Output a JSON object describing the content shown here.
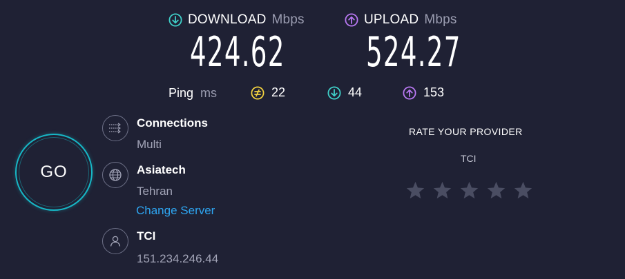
{
  "download": {
    "label": "DOWNLOAD",
    "unit": "Mbps",
    "value": "424.62",
    "color": "#3fd0c9"
  },
  "upload": {
    "label": "UPLOAD",
    "unit": "Mbps",
    "value": "524.27",
    "color": "#b878f2"
  },
  "ping": {
    "label": "Ping",
    "unit": "ms",
    "idle": {
      "value": "22",
      "icon": "idle-ping-icon",
      "color": "#f3d23f"
    },
    "download": {
      "value": "44",
      "icon": "download-ping-icon",
      "color": "#3fd0c9"
    },
    "upload": {
      "value": "153",
      "icon": "upload-ping-icon",
      "color": "#b878f2"
    }
  },
  "go_button": {
    "label": "GO",
    "color": "#17b7c6"
  },
  "connections": {
    "title": "Connections",
    "value": "Multi"
  },
  "server": {
    "name": "Asiatech",
    "location": "Tehran",
    "change_label": "Change Server"
  },
  "isp": {
    "name": "TCI",
    "ip": "151.234.246.44"
  },
  "rate": {
    "title": "RATE YOUR PROVIDER",
    "provider": "TCI",
    "stars": 5,
    "star_color": "#4a4d62"
  }
}
